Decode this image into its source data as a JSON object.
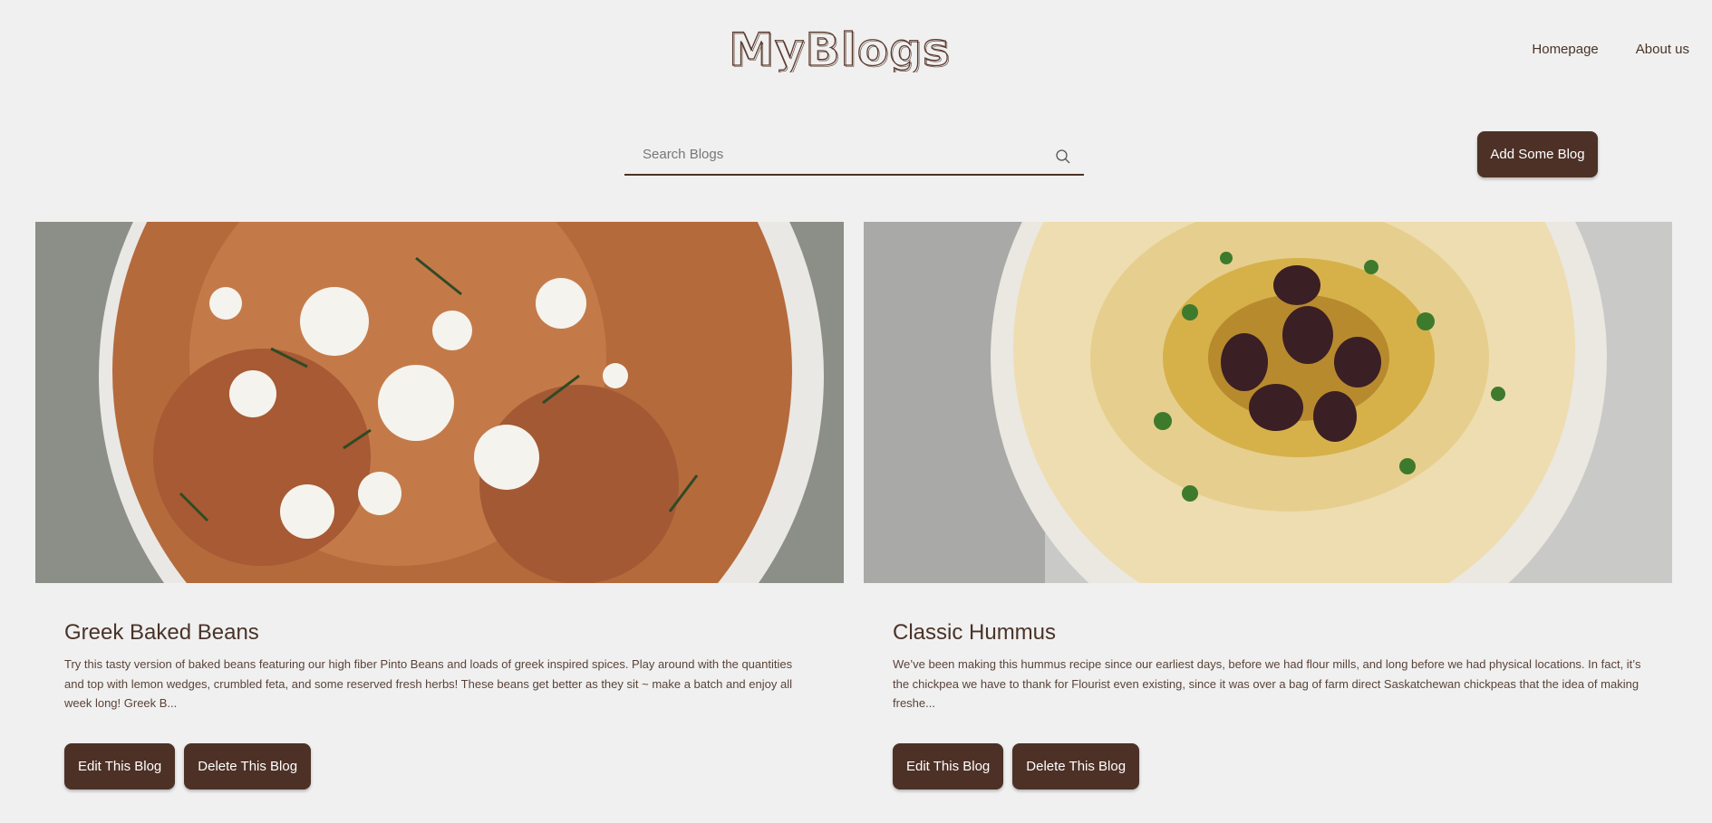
{
  "header": {
    "logo_text": "MyBlogs",
    "nav": [
      "Homepage",
      "About us"
    ]
  },
  "search": {
    "placeholder": "Search Blogs"
  },
  "actions": {
    "add_label": "Add Some Blog"
  },
  "colors": {
    "background": "#f0f0f0",
    "brand_brown": "#4d3127",
    "text": "#4a3328"
  },
  "blogs": [
    {
      "title": "Greek Baked Beans",
      "excerpt": "Try this tasty version of baked beans featuring our high fiber Pinto Beans and loads of greek inspired spices. Play around with the quantities and top with lemon wedges, crumbled feta, and some reserved fresh herbs! These beans get better as they sit ~ make a batch and enjoy all week long! Greek B...",
      "edit_label": "Edit This Blog",
      "delete_label": "Delete This Blog"
    },
    {
      "title": "Classic Hummus",
      "excerpt": "We’ve been making this hummus recipe since our earliest days, before we had flour mills, and long before we had physical locations.   In fact, it’s the chickpea we have to thank for Flourist even existing, since it was over a bag of farm direct Saskatchewan chickpeas that the idea of making freshe...",
      "edit_label": "Edit This Blog",
      "delete_label": "Delete This Blog"
    }
  ]
}
